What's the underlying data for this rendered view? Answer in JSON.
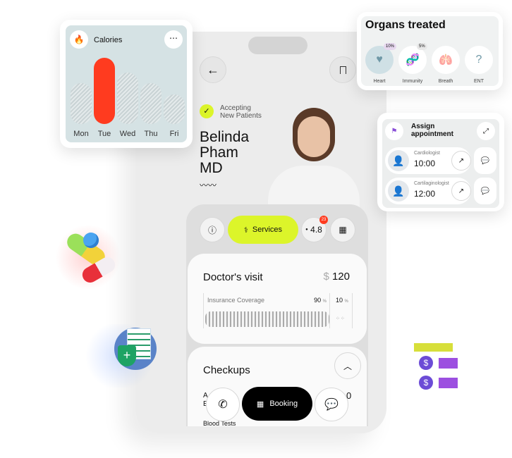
{
  "doctor": {
    "status": "Accepting New Patients",
    "status_line1": "Accepting",
    "status_line2": "New Patients",
    "name_line1": "Belinda",
    "name_line2": "Pham",
    "name_line3": "MD"
  },
  "tabs": {
    "services": "Services",
    "rating": "4.8",
    "badge": "23"
  },
  "visit": {
    "title": "Doctor's visit",
    "currency": "$",
    "price": "120",
    "coverage_label": "Insurance Coverage",
    "covered": "90",
    "uncovered": "10",
    "pct": "%"
  },
  "checkups": {
    "title": "Checkups",
    "row_a": "A",
    "row_b": "E",
    "row_value": "0",
    "next": "Blood Tests"
  },
  "bottom": {
    "booking": "Booking"
  },
  "calories": {
    "title": "Calories",
    "days": [
      "Mon",
      "Tue",
      "Wed",
      "Thu",
      "Fri"
    ],
    "levels": [
      0.55,
      0.9,
      0.7,
      0.55,
      0.4
    ],
    "active_index": 1,
    "active_color": "#ff3b1f"
  },
  "organs": {
    "title": "Organs treated",
    "items": [
      {
        "label": "Heart",
        "badge": "10%"
      },
      {
        "label": "Immunity",
        "badge": "5%"
      },
      {
        "label": "Breath"
      },
      {
        "label": "ENT"
      }
    ]
  },
  "appointment": {
    "title_line1": "Assign",
    "title_line2": "appointment",
    "rows": [
      {
        "role": "Cardiologist",
        "time": "10:00"
      },
      {
        "role": "Cartilaginologist",
        "time": "12:00"
      }
    ]
  },
  "colors": {
    "accent": "#dcf52a",
    "danger": "#ff3b1f",
    "purple": "#8a4fd8"
  }
}
